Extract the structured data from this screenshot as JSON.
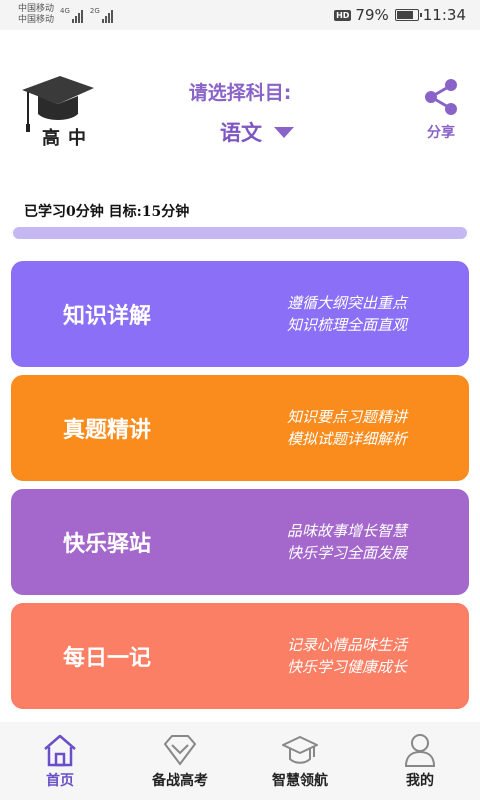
{
  "status_bar": {
    "carrier1": "中国移动",
    "carrier2": "中国移动",
    "net1": "4G",
    "net2": "2G",
    "hd": "HD",
    "battery": "79%",
    "battery_level": 0.79,
    "time": "11:34"
  },
  "header": {
    "logo_text": "高中",
    "subject_prompt": "请选择科目:",
    "subject_selected": "语文",
    "share_label": "分享"
  },
  "progress": {
    "text": "已学习0分钟 目标:15分钟",
    "fraction": 0
  },
  "cards": [
    {
      "title": "知识详解",
      "desc1": "遵循大纲突出重点",
      "desc2": "知识梳理全面直观",
      "color": "#8b6ff7"
    },
    {
      "title": "真题精讲",
      "desc1": "知识要点习题精讲",
      "desc2": "模拟试题详细解析",
      "color": "#fa8c1e"
    },
    {
      "title": "快乐驿站",
      "desc1": "品味故事增长智慧",
      "desc2": "快乐学习全面发展",
      "color": "#a468cc"
    },
    {
      "title": "每日一记",
      "desc1": "记录心情品味生活",
      "desc2": "快乐学习健康成长",
      "color": "#fb7f64"
    }
  ],
  "nav": [
    {
      "label": "首页",
      "icon": "home-icon",
      "active": true
    },
    {
      "label": "备战高考",
      "icon": "diamond-icon",
      "active": false
    },
    {
      "label": "智慧领航",
      "icon": "graduation-cap-icon",
      "active": false
    },
    {
      "label": "我的",
      "icon": "user-icon",
      "active": false
    }
  ],
  "colors": {
    "accent": "#8a63c9",
    "progress_track": "#c5b8f2",
    "nav_active": "#6a4fc9"
  }
}
